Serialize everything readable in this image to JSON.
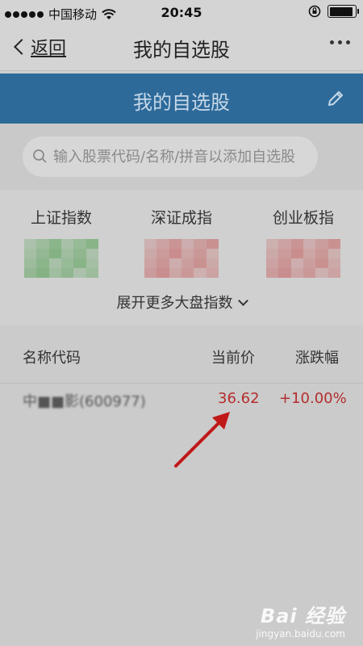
{
  "status_bar": {
    "carrier": "中国移动",
    "time": "20:45",
    "battery_level": 0.92
  },
  "nav": {
    "back_label": "返回",
    "title": "我的自选股"
  },
  "header": {
    "title": "我的自选股",
    "edit_icon": "pencil-icon",
    "color": "#2d6a9a"
  },
  "search": {
    "placeholder": "输入股票代码/名称/拼音以添加自选股",
    "value": ""
  },
  "indices": {
    "items": [
      {
        "name": "上证指数",
        "color": "#7fb07f"
      },
      {
        "name": "深证成指",
        "color": "#c98989"
      },
      {
        "name": "创业板指",
        "color": "#c98989"
      }
    ],
    "expand_label": "展开更多大盘指数"
  },
  "list": {
    "columns": [
      "名称代码",
      "当前价",
      "涨跌幅"
    ],
    "rows": [
      {
        "name_code": "中■■影(600977)",
        "price": "36.62",
        "change": "+10.00%"
      }
    ]
  },
  "colors": {
    "rise": "#b52d2d",
    "arrow": "#c01818"
  },
  "watermark": {
    "brand": "Bai 经验",
    "url": "jingyan.baidu.com"
  }
}
